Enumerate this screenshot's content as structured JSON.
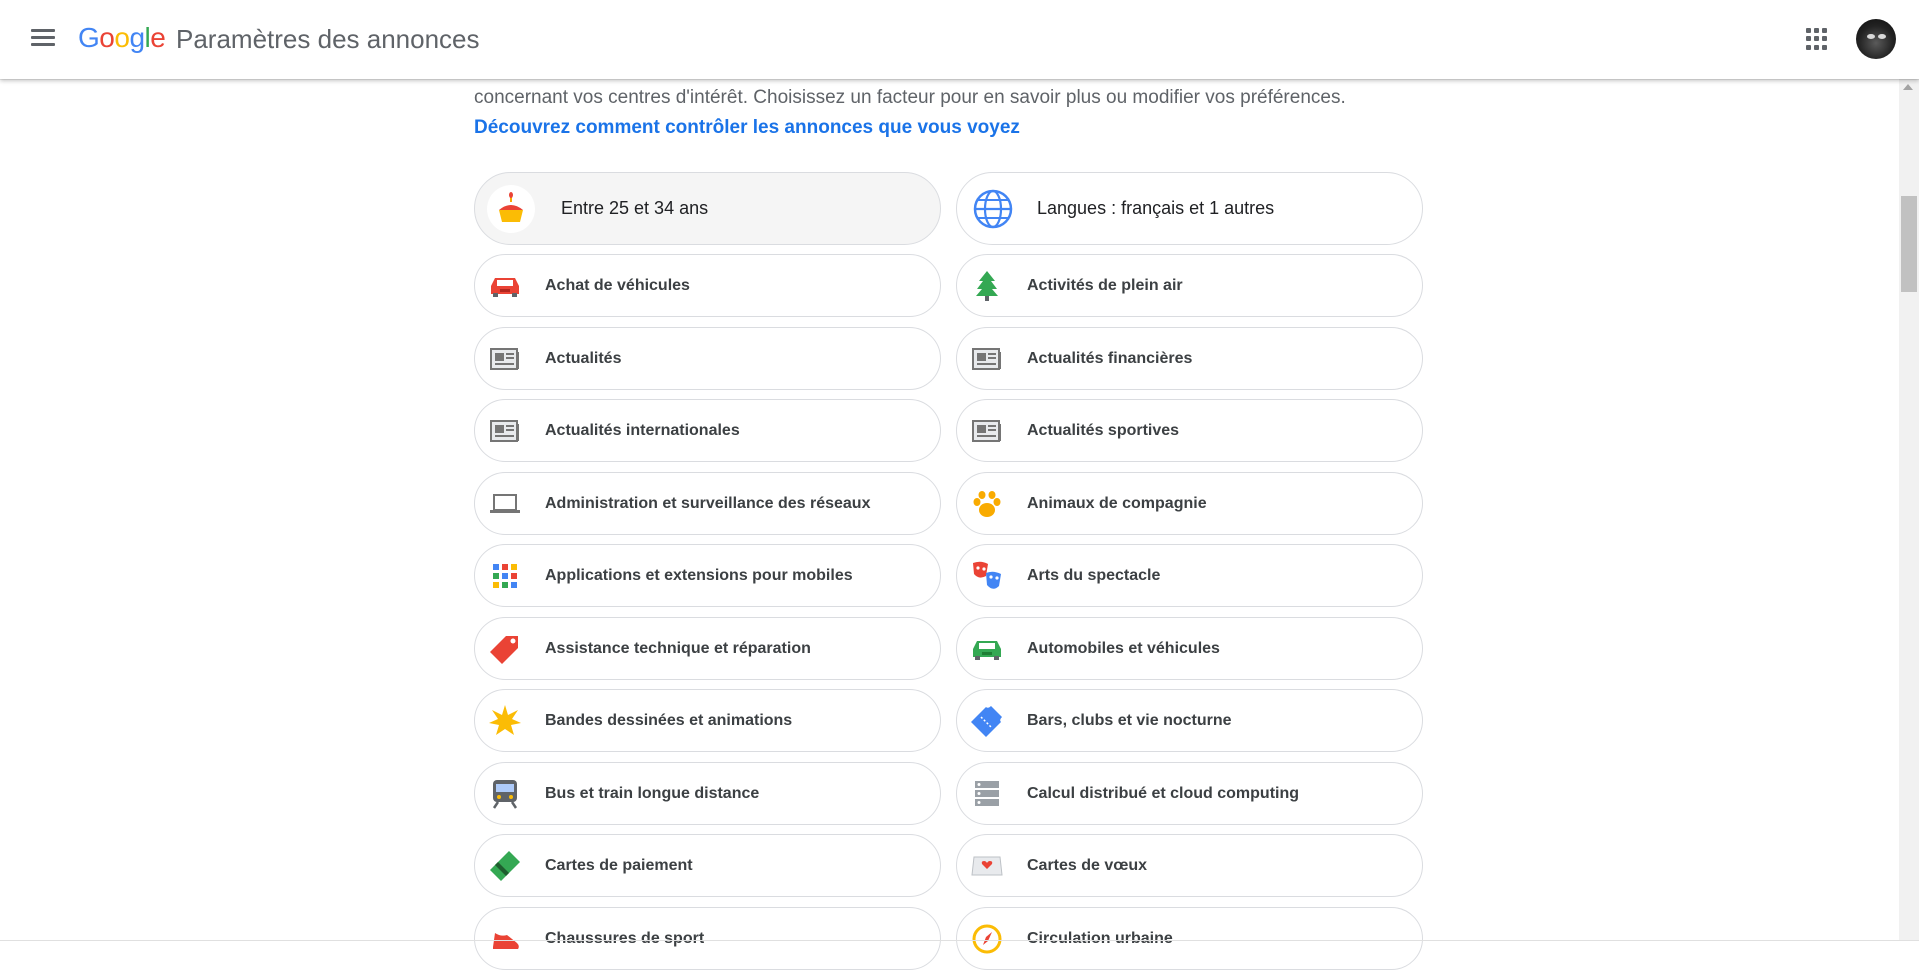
{
  "header": {
    "logo_letters": [
      "G",
      "o",
      "o",
      "g",
      "l",
      "e"
    ],
    "title": "Paramètres des annonces"
  },
  "intro": {
    "text": "concernant vos centres d'intérêt. Choisissez un facteur pour en savoir plus ou modifier vos préférences.",
    "link": "Découvrez comment contrôler les annonces que vous voyez"
  },
  "factors": [
    {
      "label": "Entre 25 et 34 ans",
      "icon": "cupcake-icon"
    },
    {
      "label": "Langues : français et 1 autres",
      "icon": "globe-icon"
    },
    {
      "label": "Achat de véhicules",
      "icon": "car-icon",
      "color": "#ea4335"
    },
    {
      "label": "Activités de plein air",
      "icon": "tree-icon",
      "color": "#34a853"
    },
    {
      "label": "Actualités",
      "icon": "newspaper-icon",
      "color": "#757575"
    },
    {
      "label": "Actualités financières",
      "icon": "newspaper-icon",
      "color": "#757575"
    },
    {
      "label": "Actualités internationales",
      "icon": "newspaper-icon",
      "color": "#757575"
    },
    {
      "label": "Actualités sportives",
      "icon": "newspaper-icon",
      "color": "#757575"
    },
    {
      "label": "Administration et surveillance des réseaux",
      "icon": "laptop-icon",
      "color": "#757575"
    },
    {
      "label": "Animaux de compagnie",
      "icon": "paw-icon",
      "color": "#f9ab00"
    },
    {
      "label": "Applications et extensions pour mobiles",
      "icon": "apps-grid-icon"
    },
    {
      "label": "Arts du spectacle",
      "icon": "theater-masks-icon"
    },
    {
      "label": "Assistance technique et réparation",
      "icon": "tag-icon",
      "color": "#ea4335"
    },
    {
      "label": "Automobiles et véhicules",
      "icon": "car-icon",
      "color": "#34a853"
    },
    {
      "label": "Bandes dessinées et animations",
      "icon": "star-burst-icon",
      "color": "#fbbc05"
    },
    {
      "label": "Bars, clubs et vie nocturne",
      "icon": "ticket-icon",
      "color": "#4285f4"
    },
    {
      "label": "Bus et train longue distance",
      "icon": "train-icon",
      "color": "#5f6368"
    },
    {
      "label": "Calcul distribué et cloud computing",
      "icon": "server-icon",
      "color": "#757575"
    },
    {
      "label": "Cartes de paiement",
      "icon": "credit-card-icon",
      "color": "#34a853"
    },
    {
      "label": "Cartes de vœux",
      "icon": "greeting-card-icon",
      "color": "#ea4335"
    },
    {
      "label": "Chaussures de sport",
      "icon": "shoe-icon",
      "color": "#ea4335"
    },
    {
      "label": "Circulation urbaine",
      "icon": "compass-icon",
      "color": "#fbbc05"
    }
  ]
}
